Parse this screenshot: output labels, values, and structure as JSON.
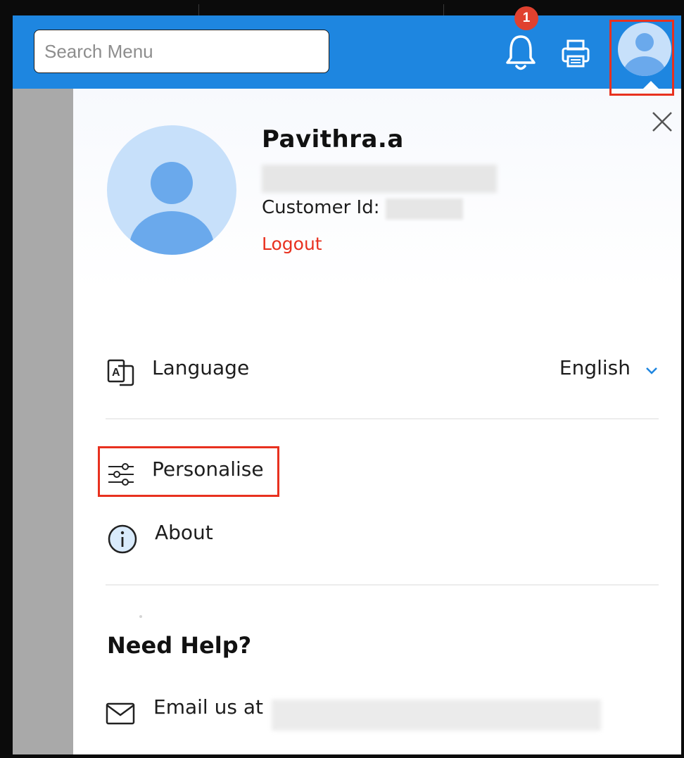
{
  "header": {
    "search_placeholder": "Search Menu",
    "notification_count": "1",
    "accent_color": "#1e86e0",
    "badge_color": "#e0412f"
  },
  "profile": {
    "name": "Pavithra.a",
    "customer_id_label": "Customer Id:",
    "logout_label": "Logout"
  },
  "menu": {
    "language_label": "Language",
    "language_value": "English",
    "personalise_label": "Personalise",
    "about_label": "About"
  },
  "help": {
    "title": "Need Help?",
    "email_label": "Email us at"
  },
  "icons": [
    "bell-icon",
    "printer-icon",
    "avatar-icon",
    "close-icon",
    "language-icon",
    "chevron-down-icon",
    "sliders-icon",
    "info-icon",
    "mail-icon"
  ],
  "highlight_color": "#e8311f"
}
